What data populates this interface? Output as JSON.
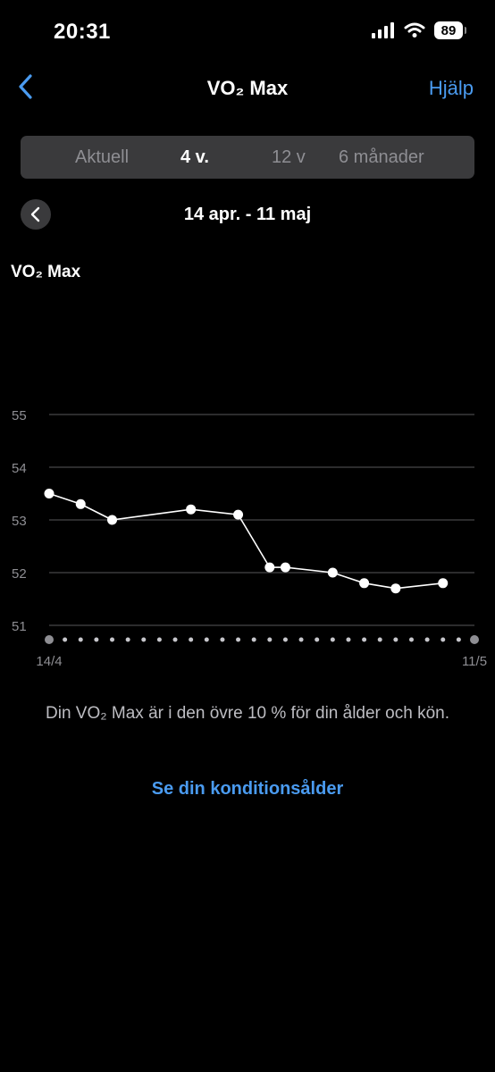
{
  "status_bar": {
    "time": "20:31",
    "battery": "89"
  },
  "nav": {
    "back_icon": "chevron-left-icon",
    "title": "VO₂ Max",
    "help": "Hjälp"
  },
  "segments": [
    {
      "label": "Aktuell",
      "active": false
    },
    {
      "label": "4 v.",
      "active": true
    },
    {
      "label": "12 v",
      "active": false
    },
    {
      "label": "6 månader",
      "active": false
    }
  ],
  "range": {
    "label": "14 apr. - 11 maj"
  },
  "chart_title": "VO₂ Max",
  "chart_data": {
    "type": "line",
    "title": "VO₂ Max",
    "x_range": [
      "14/4",
      "11/5"
    ],
    "x_tick_labels": [
      "14/4",
      "11/5"
    ],
    "ylim": [
      51,
      55
    ],
    "y_ticks": [
      51,
      52,
      53,
      54,
      55
    ],
    "grid": true,
    "series": [
      {
        "points": [
          {
            "day": 0,
            "y": 53.5
          },
          {
            "day": 2,
            "y": 53.3
          },
          {
            "day": 4,
            "y": 53.0
          },
          {
            "day": 9,
            "y": 53.2
          },
          {
            "day": 12,
            "y": 53.1
          },
          {
            "day": 14,
            "y": 52.1
          },
          {
            "day": 15,
            "y": 52.1
          },
          {
            "day": 18,
            "y": 52.0
          },
          {
            "day": 20,
            "y": 51.8
          },
          {
            "day": 22,
            "y": 51.7
          },
          {
            "day": 25,
            "y": 51.8
          }
        ]
      }
    ],
    "colors": {
      "line": "#ffffff",
      "grid": "#3a3a3c",
      "axis_dots": "#8e8e93"
    }
  },
  "summary": "Din VO₂ Max är i den övre 10 % för din ålder och kön.",
  "cta": "Se din konditionsålder"
}
